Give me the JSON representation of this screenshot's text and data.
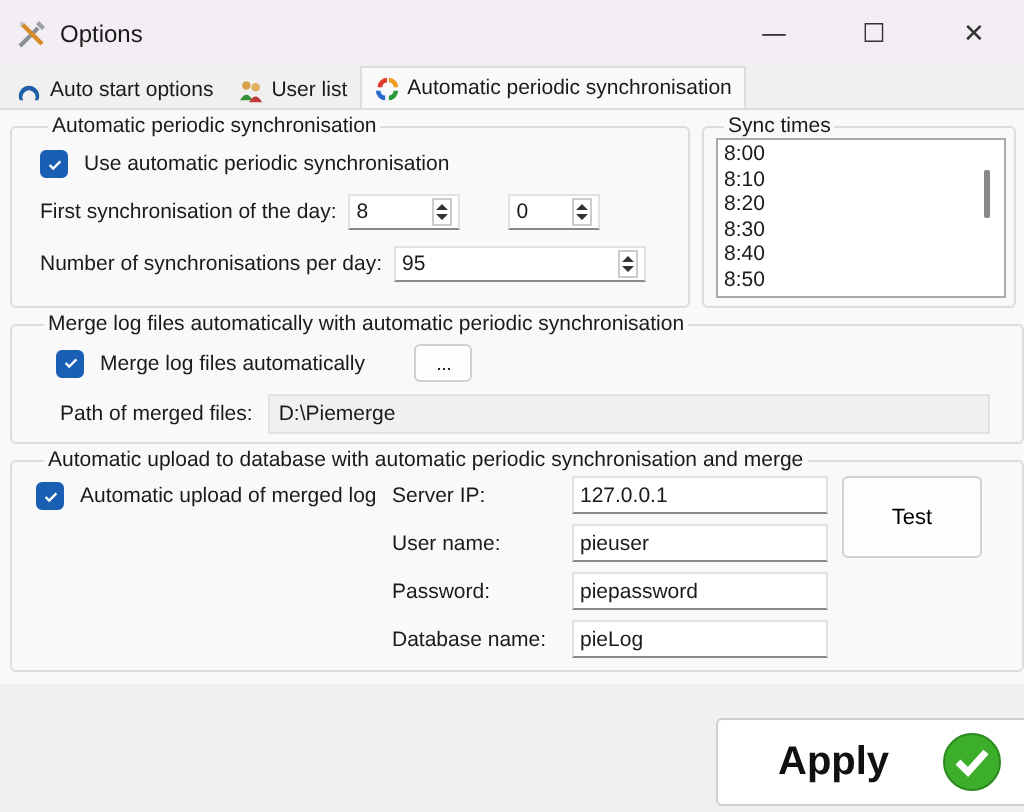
{
  "window": {
    "title": "Options",
    "controls": [
      "—",
      "☐",
      "✕"
    ]
  },
  "tabs": [
    {
      "label": "Auto start options",
      "selected": false,
      "kind": "autostart"
    },
    {
      "label": "User list",
      "selected": false,
      "kind": "users"
    },
    {
      "label": "Automatic periodic synchronisation",
      "selected": true,
      "kind": "sync"
    }
  ],
  "sync_group": {
    "title": "Automatic periodic synchronisation",
    "use_checkbox": {
      "label": "Use automatic periodic synchronisation",
      "checked": true
    },
    "first_sync": {
      "label": "First synchronisation of the day:",
      "hour": "8",
      "minute": "0"
    },
    "count": {
      "label": "Number of synchronisations per day:",
      "value": "95"
    }
  },
  "sync_times": {
    "title": "Sync times",
    "items": [
      "8:00",
      "8:10",
      "8:20",
      "8:30",
      "8:40",
      "8:50"
    ]
  },
  "merge_group": {
    "title": "Merge log files automatically with automatic periodic synchronisation",
    "checkbox": {
      "label": "Merge log files automatically",
      "checked": true
    },
    "browse_button": "...",
    "path": {
      "label": "Path of merged files:",
      "value": "D:\\Piemerge"
    }
  },
  "upload_group": {
    "title": "Automatic upload to database with automatic periodic synchronisation and merge",
    "checkbox": {
      "label": "Automatic upload of merged log",
      "checked": true
    },
    "fields": [
      {
        "label": "Server IP:",
        "value": "127.0.0.1"
      },
      {
        "label": "User name:",
        "value": "pieuser"
      },
      {
        "label": "Password:",
        "value": "piepassword"
      },
      {
        "label": "Database name:",
        "value": "pieLog"
      }
    ],
    "test_button": "Test"
  },
  "apply_button": "Apply"
}
